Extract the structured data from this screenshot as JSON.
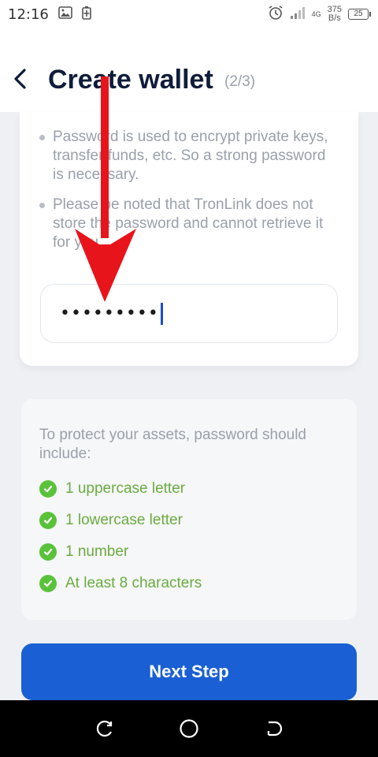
{
  "status_bar": {
    "time": "12:16",
    "speed_value": "375",
    "speed_unit": "B/s",
    "battery": "25",
    "network": "4G"
  },
  "header": {
    "title": "Create wallet",
    "step": "(2/3)"
  },
  "notes": [
    "Password is used to encrypt private keys, transfer funds, etc. So a strong password is necessary.",
    "Please be noted that TronLink does not store the password and cannot retrieve it for you."
  ],
  "password_input": {
    "value": "•••••••••"
  },
  "requirements": {
    "intro": "To protect your assets, password should include:",
    "items": [
      "1 uppercase letter",
      "1 lowercase letter",
      "1 number",
      "At least 8 characters"
    ]
  },
  "next_button": {
    "label": "Next Step"
  },
  "colors": {
    "primary": "#1a5fd3",
    "check_green": "#5ac23a",
    "requirement_text": "#6aac3f",
    "arrow_red": "#e8141b"
  }
}
